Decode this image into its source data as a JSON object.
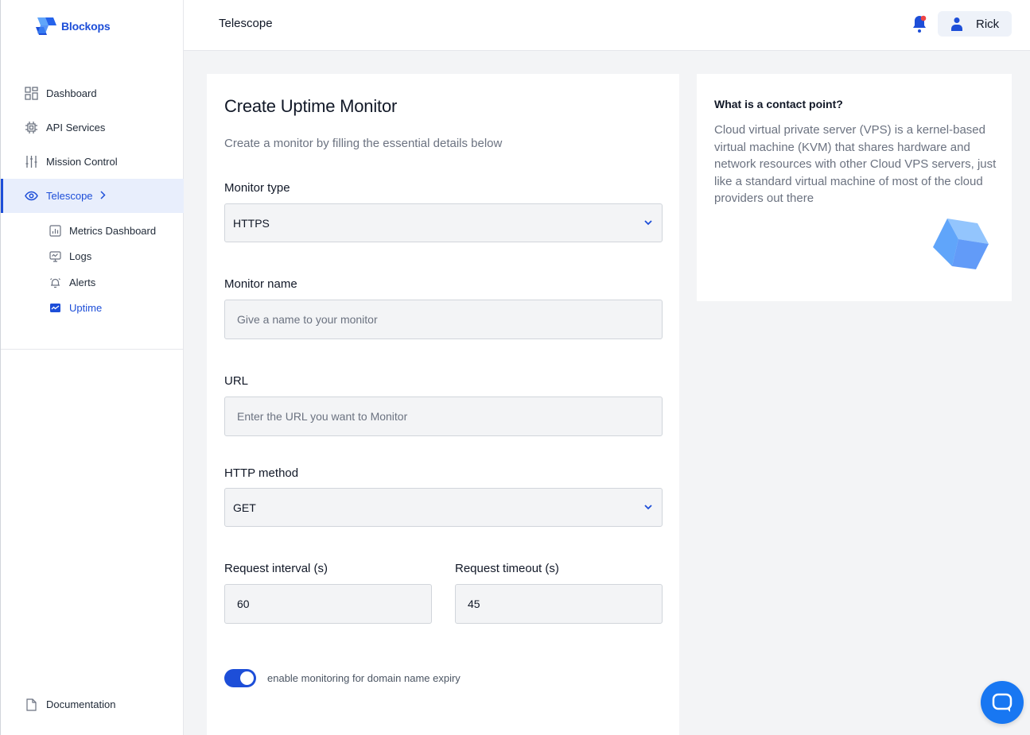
{
  "brand": {
    "name": "Blockops"
  },
  "sidebar": {
    "items": [
      {
        "label": "Dashboard",
        "icon": "dashboard-icon"
      },
      {
        "label": "API Services",
        "icon": "chip-icon"
      },
      {
        "label": "Mission Control",
        "icon": "sliders-icon"
      },
      {
        "label": "Telescope",
        "icon": "eye-icon",
        "active": true
      }
    ],
    "subitems": [
      {
        "label": "Metrics Dashboard",
        "icon": "bar-chart-icon"
      },
      {
        "label": "Logs",
        "icon": "monitor-icon"
      },
      {
        "label": "Alerts",
        "icon": "alarm-icon"
      },
      {
        "label": "Uptime",
        "icon": "uptime-icon",
        "active": true
      }
    ],
    "footer": {
      "label": "Documentation",
      "icon": "document-icon"
    }
  },
  "header": {
    "title": "Telescope",
    "user_name": "Rick"
  },
  "form": {
    "title": "Create Uptime Monitor",
    "subtitle": "Create a monitor by filling the essential details below",
    "monitor_type": {
      "label": "Monitor type",
      "value": "HTTPS"
    },
    "monitor_name": {
      "label": "Monitor name",
      "placeholder": "Give a name to your monitor",
      "value": ""
    },
    "url": {
      "label": "URL",
      "placeholder": "Enter the URL you want to Monitor",
      "value": ""
    },
    "http_method": {
      "label": "HTTP method",
      "value": "GET"
    },
    "request_interval": {
      "label": "Request interval (s)",
      "value": "60"
    },
    "request_timeout": {
      "label": "Request timeout (s)",
      "value": "45"
    },
    "domain_expiry": {
      "label": "enable monitoring for domain name expiry",
      "enabled": true
    }
  },
  "info": {
    "title": "What is a contact point?",
    "body": "Cloud virtual private server (VPS) is a kernel-based virtual machine (KVM) that shares hardware and network resources with other Cloud VPS servers, just like a standard virtual machine of most of the cloud providers out there"
  },
  "colors": {
    "accent": "#1d4ed8",
    "active_bg": "#e8eefc",
    "chat": "#1877f2",
    "notification_dot": "#ef4444"
  }
}
